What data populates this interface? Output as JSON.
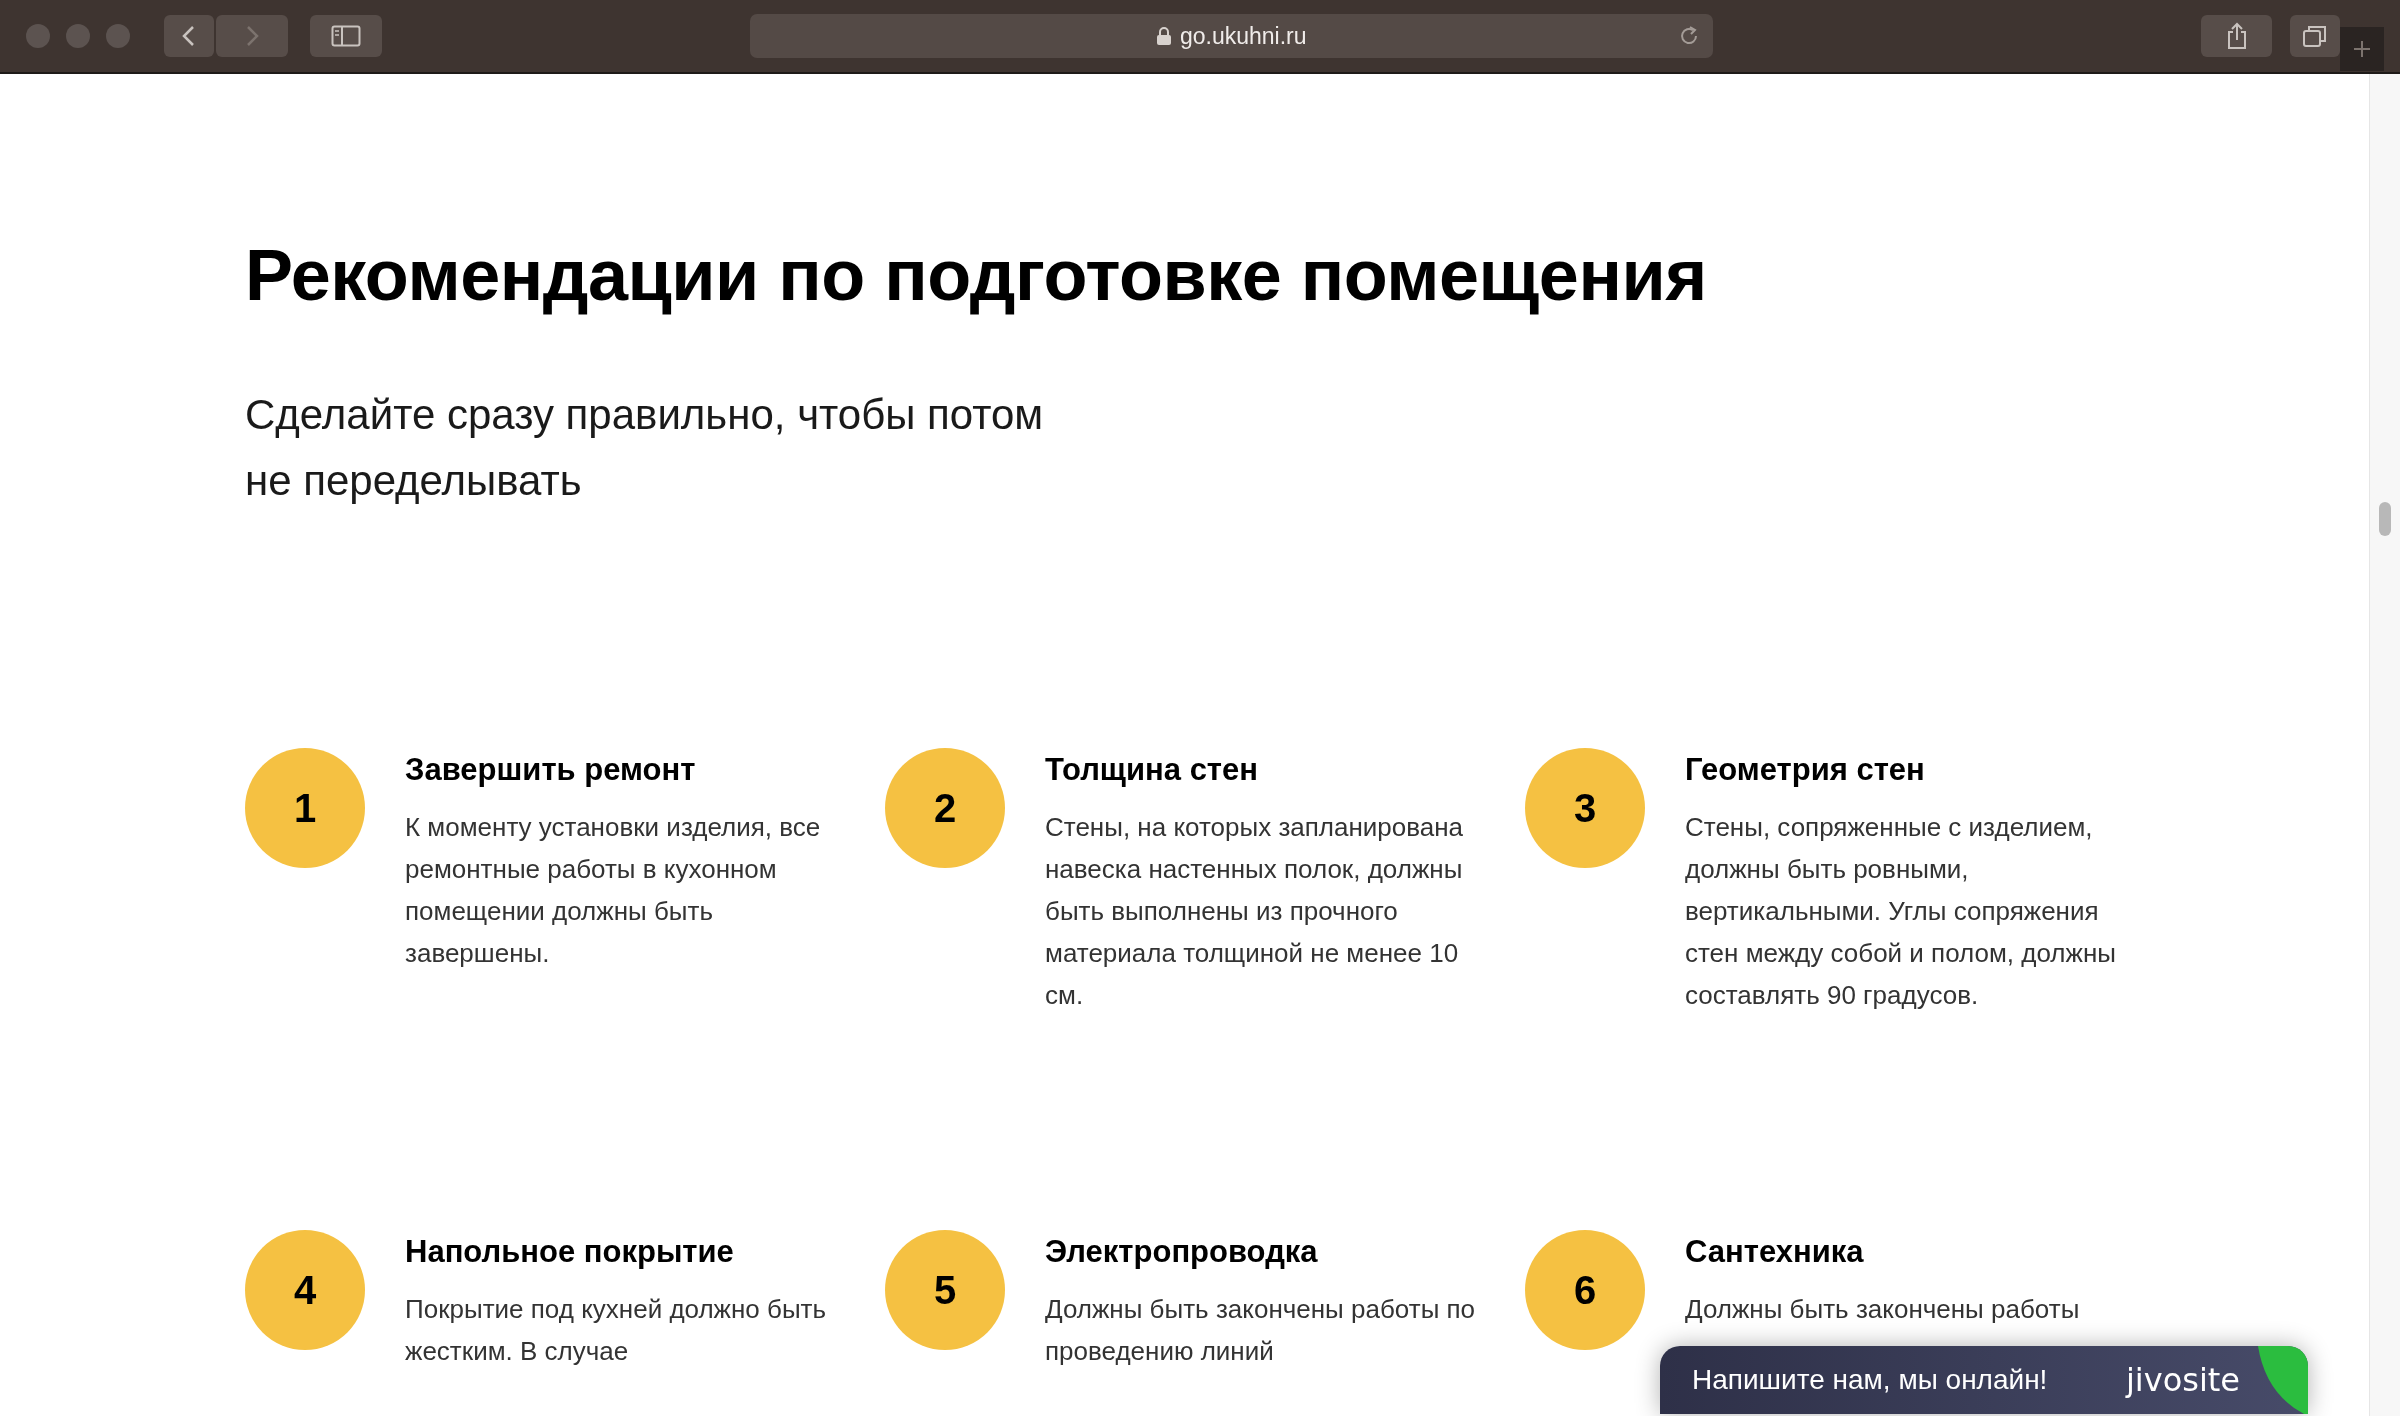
{
  "browser": {
    "url": "go.ukuhni.ru"
  },
  "heading": "Рекомендации по подготовке помещения",
  "subtitle": "Сделайте сразу правильно, чтобы потом не переделывать",
  "steps": [
    {
      "number": "1",
      "title": "Завершить ремонт",
      "body": "К моменту установки изделия, все ремонтные работы в кухонном помещении должны быть завершены."
    },
    {
      "number": "2",
      "title": "Толщина стен",
      "body": "Стены, на которых запланирована навеска настенных полок, должны быть выполнены из прочного материала толщиной не менее 10 см."
    },
    {
      "number": "3",
      "title": "Геометрия стен",
      "body": "Стены, сопряженные с изделием, должны быть ровными, вертикальными. Углы сопряжения стен между собой и полом, должны составлять 90 градусов."
    },
    {
      "number": "4",
      "title": "Напольное покрытие",
      "body": "Покрытие под кухней должно быть жестким. В случае"
    },
    {
      "number": "5",
      "title": "Электропроводка",
      "body": "Должны быть закончены работы по проведению линий"
    },
    {
      "number": "6",
      "title": "Сантехника",
      "body": "Должны быть закончены работы"
    }
  ],
  "chat_widget": {
    "message": "Напишите нам, мы онлайн!",
    "logo": "jivosite"
  }
}
